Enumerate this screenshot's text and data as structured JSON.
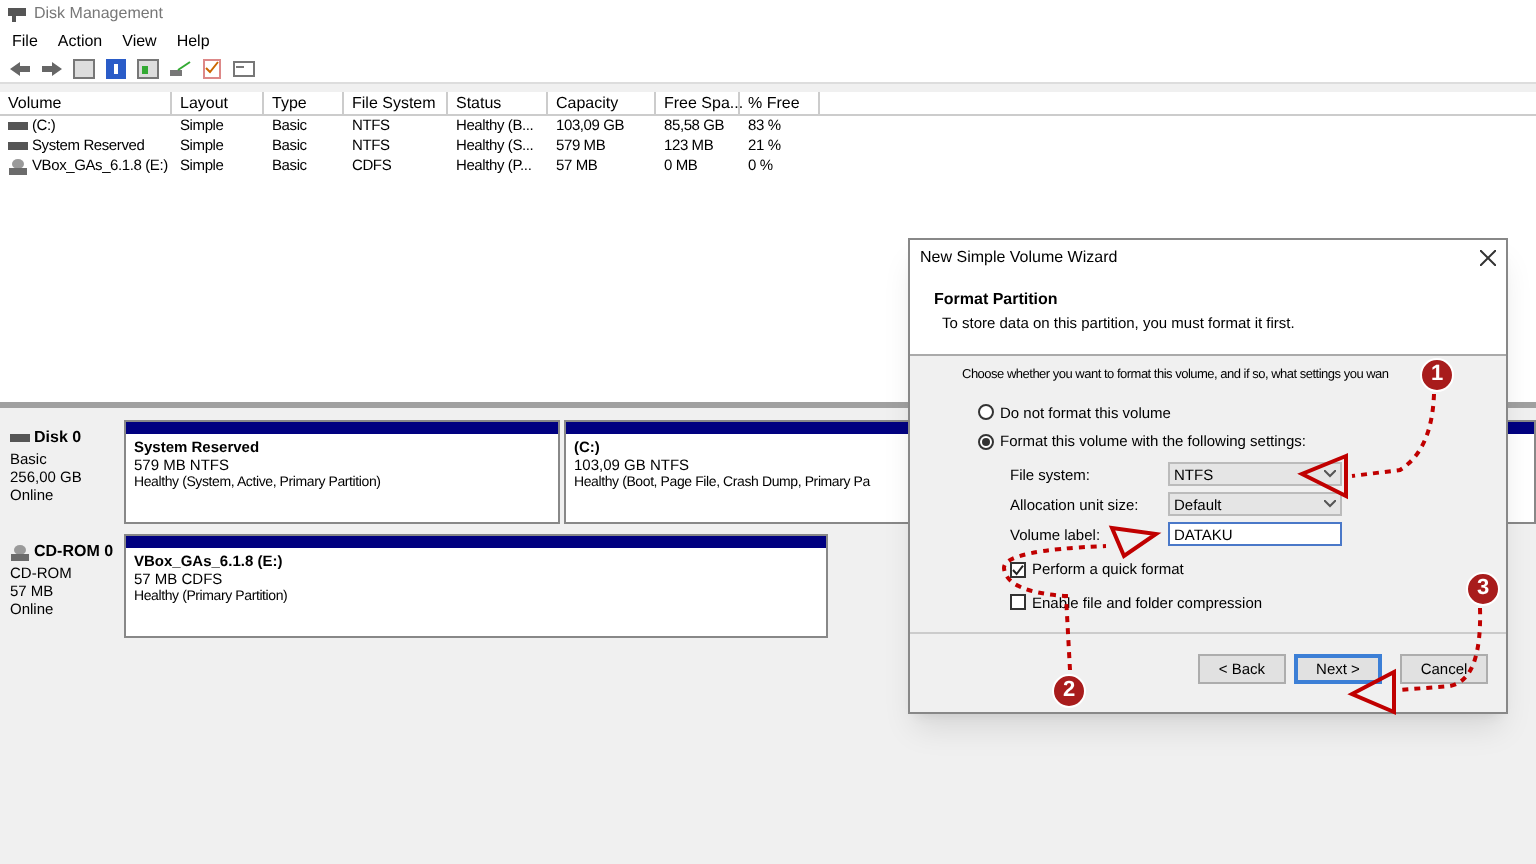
{
  "window": {
    "title": "Disk Management"
  },
  "menu": [
    "File",
    "Action",
    "View",
    "Help"
  ],
  "volumes": {
    "columns": [
      "Volume",
      "Layout",
      "Type",
      "File System",
      "Status",
      "Capacity",
      "Free Spa...",
      "% Free"
    ],
    "rows": [
      {
        "kind": "disk",
        "cells": [
          "(C:)",
          "Simple",
          "Basic",
          "NTFS",
          "Healthy (B...",
          "103,09 GB",
          "85,58 GB",
          "83 %"
        ]
      },
      {
        "kind": "disk",
        "cells": [
          "System Reserved",
          "Simple",
          "Basic",
          "NTFS",
          "Healthy (S...",
          "579 MB",
          "123 MB",
          "21 %"
        ]
      },
      {
        "kind": "cdrom",
        "cells": [
          "VBox_GAs_6.1.8 (E:)",
          "Simple",
          "Basic",
          "CDFS",
          "Healthy (P...",
          "57 MB",
          "0 MB",
          "0 %"
        ]
      }
    ]
  },
  "disks": [
    {
      "kind": "disk",
      "name": "Disk 0",
      "lines": [
        "Basic",
        "256,00 GB",
        "Online"
      ],
      "partitions": [
        {
          "title": "System Reserved",
          "size": "579 MB NTFS",
          "status": "Healthy (System, Active, Primary Partition)"
        },
        {
          "title": "(C:)",
          "size": "103,09 GB NTFS",
          "status": "Healthy (Boot, Page File, Crash Dump, Primary Pa"
        }
      ]
    },
    {
      "kind": "cdrom",
      "name": "CD-ROM 0",
      "lines": [
        "CD-ROM",
        "57 MB",
        "Online"
      ],
      "partitions": [
        {
          "title": "VBox_GAs_6.1.8  (E:)",
          "size": "57 MB CDFS",
          "status": "Healthy (Primary Partition)"
        }
      ]
    }
  ],
  "dialog": {
    "title": "New Simple Volume Wizard",
    "heading": "Format Partition",
    "subheading": "To store data on this partition, you must format it first.",
    "prompt": "Choose whether you want to format this volume, and if so, what settings you wan",
    "options": [
      {
        "label": "Do not format this volume",
        "selected": false
      },
      {
        "label": "Format this volume with the following settings:",
        "selected": true
      }
    ],
    "fields": [
      {
        "kind": "select",
        "label": "File system:",
        "value": "NTFS"
      },
      {
        "kind": "select",
        "label": "Allocation unit size:",
        "value": "Default"
      },
      {
        "kind": "text",
        "label": "Volume label:",
        "value": "DATAKU"
      }
    ],
    "checks": [
      {
        "label": "Perform a quick format",
        "checked": true
      },
      {
        "label": "Enable file and folder compression",
        "checked": false
      }
    ],
    "buttons": [
      {
        "label": "< Back",
        "default": false
      },
      {
        "label": "Next >",
        "default": true
      },
      {
        "label": "Cancel",
        "default": false
      }
    ]
  },
  "steps": [
    "1",
    "2",
    "3"
  ]
}
